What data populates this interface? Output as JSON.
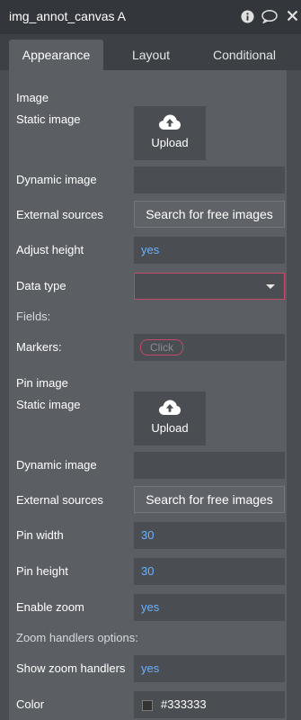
{
  "window": {
    "title": "img_annot_canvas A"
  },
  "tabs": [
    {
      "label": "Appearance",
      "active": true
    },
    {
      "label": "Layout",
      "active": false
    },
    {
      "label": "Conditional",
      "active": false
    }
  ],
  "image_section": {
    "title": "Image",
    "static_image_label": "Static image",
    "upload_label": "Upload",
    "dynamic_image_label": "Dynamic image",
    "dynamic_image_value": "",
    "external_sources_label": "External sources",
    "search_button": "Search for free images",
    "adjust_height_label": "Adjust height",
    "adjust_height_value": "yes",
    "data_type_label": "Data type",
    "data_type_value": ""
  },
  "fields_section": {
    "title": "Fields:",
    "markers_label": "Markers:",
    "markers_placeholder": "Click"
  },
  "pin_section": {
    "title": "Pin image",
    "static_image_label": "Static image",
    "upload_label": "Upload",
    "dynamic_image_label": "Dynamic image",
    "dynamic_image_value": "",
    "external_sources_label": "External sources",
    "search_button": "Search for free images",
    "pin_width_label": "Pin width",
    "pin_width_value": "30",
    "pin_height_label": "Pin height",
    "pin_height_value": "30",
    "enable_zoom_label": "Enable zoom",
    "enable_zoom_value": "yes"
  },
  "zoom_section": {
    "title": "Zoom handlers options:",
    "show_zoom_label": "Show zoom handlers",
    "show_zoom_value": "yes",
    "color_label": "Color",
    "color_value": "#333333"
  },
  "colors": {
    "accent_value": "#6ab0ff",
    "error_border": "#c24a6a",
    "panel_bg": "#5b5f64",
    "header_bg": "#33363a"
  }
}
